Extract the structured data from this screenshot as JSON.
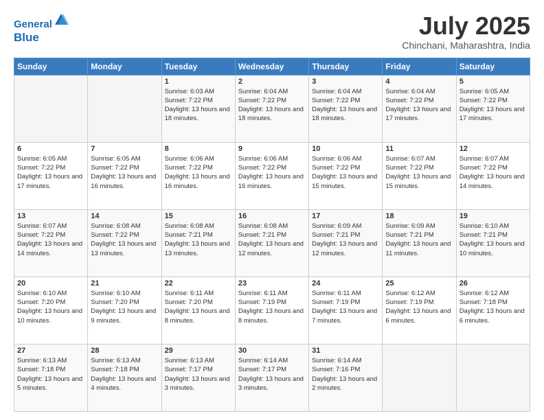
{
  "header": {
    "logo_line1": "General",
    "logo_line2": "Blue",
    "month_title": "July 2025",
    "location": "Chinchani, Maharashtra, India"
  },
  "days_of_week": [
    "Sunday",
    "Monday",
    "Tuesday",
    "Wednesday",
    "Thursday",
    "Friday",
    "Saturday"
  ],
  "weeks": [
    [
      {
        "day": "",
        "sunrise": "",
        "sunset": "",
        "daylight": ""
      },
      {
        "day": "",
        "sunrise": "",
        "sunset": "",
        "daylight": ""
      },
      {
        "day": "1",
        "sunrise": "Sunrise: 6:03 AM",
        "sunset": "Sunset: 7:22 PM",
        "daylight": "Daylight: 13 hours and 18 minutes."
      },
      {
        "day": "2",
        "sunrise": "Sunrise: 6:04 AM",
        "sunset": "Sunset: 7:22 PM",
        "daylight": "Daylight: 13 hours and 18 minutes."
      },
      {
        "day": "3",
        "sunrise": "Sunrise: 6:04 AM",
        "sunset": "Sunset: 7:22 PM",
        "daylight": "Daylight: 13 hours and 18 minutes."
      },
      {
        "day": "4",
        "sunrise": "Sunrise: 6:04 AM",
        "sunset": "Sunset: 7:22 PM",
        "daylight": "Daylight: 13 hours and 17 minutes."
      },
      {
        "day": "5",
        "sunrise": "Sunrise: 6:05 AM",
        "sunset": "Sunset: 7:22 PM",
        "daylight": "Daylight: 13 hours and 17 minutes."
      }
    ],
    [
      {
        "day": "6",
        "sunrise": "Sunrise: 6:05 AM",
        "sunset": "Sunset: 7:22 PM",
        "daylight": "Daylight: 13 hours and 17 minutes."
      },
      {
        "day": "7",
        "sunrise": "Sunrise: 6:05 AM",
        "sunset": "Sunset: 7:22 PM",
        "daylight": "Daylight: 13 hours and 16 minutes."
      },
      {
        "day": "8",
        "sunrise": "Sunrise: 6:06 AM",
        "sunset": "Sunset: 7:22 PM",
        "daylight": "Daylight: 13 hours and 16 minutes."
      },
      {
        "day": "9",
        "sunrise": "Sunrise: 6:06 AM",
        "sunset": "Sunset: 7:22 PM",
        "daylight": "Daylight: 13 hours and 16 minutes."
      },
      {
        "day": "10",
        "sunrise": "Sunrise: 6:06 AM",
        "sunset": "Sunset: 7:22 PM",
        "daylight": "Daylight: 13 hours and 15 minutes."
      },
      {
        "day": "11",
        "sunrise": "Sunrise: 6:07 AM",
        "sunset": "Sunset: 7:22 PM",
        "daylight": "Daylight: 13 hours and 15 minutes."
      },
      {
        "day": "12",
        "sunrise": "Sunrise: 6:07 AM",
        "sunset": "Sunset: 7:22 PM",
        "daylight": "Daylight: 13 hours and 14 minutes."
      }
    ],
    [
      {
        "day": "13",
        "sunrise": "Sunrise: 6:07 AM",
        "sunset": "Sunset: 7:22 PM",
        "daylight": "Daylight: 13 hours and 14 minutes."
      },
      {
        "day": "14",
        "sunrise": "Sunrise: 6:08 AM",
        "sunset": "Sunset: 7:22 PM",
        "daylight": "Daylight: 13 hours and 13 minutes."
      },
      {
        "day": "15",
        "sunrise": "Sunrise: 6:08 AM",
        "sunset": "Sunset: 7:21 PM",
        "daylight": "Daylight: 13 hours and 13 minutes."
      },
      {
        "day": "16",
        "sunrise": "Sunrise: 6:08 AM",
        "sunset": "Sunset: 7:21 PM",
        "daylight": "Daylight: 13 hours and 12 minutes."
      },
      {
        "day": "17",
        "sunrise": "Sunrise: 6:09 AM",
        "sunset": "Sunset: 7:21 PM",
        "daylight": "Daylight: 13 hours and 12 minutes."
      },
      {
        "day": "18",
        "sunrise": "Sunrise: 6:09 AM",
        "sunset": "Sunset: 7:21 PM",
        "daylight": "Daylight: 13 hours and 11 minutes."
      },
      {
        "day": "19",
        "sunrise": "Sunrise: 6:10 AM",
        "sunset": "Sunset: 7:21 PM",
        "daylight": "Daylight: 13 hours and 10 minutes."
      }
    ],
    [
      {
        "day": "20",
        "sunrise": "Sunrise: 6:10 AM",
        "sunset": "Sunset: 7:20 PM",
        "daylight": "Daylight: 13 hours and 10 minutes."
      },
      {
        "day": "21",
        "sunrise": "Sunrise: 6:10 AM",
        "sunset": "Sunset: 7:20 PM",
        "daylight": "Daylight: 13 hours and 9 minutes."
      },
      {
        "day": "22",
        "sunrise": "Sunrise: 6:11 AM",
        "sunset": "Sunset: 7:20 PM",
        "daylight": "Daylight: 13 hours and 8 minutes."
      },
      {
        "day": "23",
        "sunrise": "Sunrise: 6:11 AM",
        "sunset": "Sunset: 7:19 PM",
        "daylight": "Daylight: 13 hours and 8 minutes."
      },
      {
        "day": "24",
        "sunrise": "Sunrise: 6:11 AM",
        "sunset": "Sunset: 7:19 PM",
        "daylight": "Daylight: 13 hours and 7 minutes."
      },
      {
        "day": "25",
        "sunrise": "Sunrise: 6:12 AM",
        "sunset": "Sunset: 7:19 PM",
        "daylight": "Daylight: 13 hours and 6 minutes."
      },
      {
        "day": "26",
        "sunrise": "Sunrise: 6:12 AM",
        "sunset": "Sunset: 7:18 PM",
        "daylight": "Daylight: 13 hours and 6 minutes."
      }
    ],
    [
      {
        "day": "27",
        "sunrise": "Sunrise: 6:13 AM",
        "sunset": "Sunset: 7:18 PM",
        "daylight": "Daylight: 13 hours and 5 minutes."
      },
      {
        "day": "28",
        "sunrise": "Sunrise: 6:13 AM",
        "sunset": "Sunset: 7:18 PM",
        "daylight": "Daylight: 13 hours and 4 minutes."
      },
      {
        "day": "29",
        "sunrise": "Sunrise: 6:13 AM",
        "sunset": "Sunset: 7:17 PM",
        "daylight": "Daylight: 13 hours and 3 minutes."
      },
      {
        "day": "30",
        "sunrise": "Sunrise: 6:14 AM",
        "sunset": "Sunset: 7:17 PM",
        "daylight": "Daylight: 13 hours and 3 minutes."
      },
      {
        "day": "31",
        "sunrise": "Sunrise: 6:14 AM",
        "sunset": "Sunset: 7:16 PM",
        "daylight": "Daylight: 13 hours and 2 minutes."
      },
      {
        "day": "",
        "sunrise": "",
        "sunset": "",
        "daylight": ""
      },
      {
        "day": "",
        "sunrise": "",
        "sunset": "",
        "daylight": ""
      }
    ]
  ]
}
